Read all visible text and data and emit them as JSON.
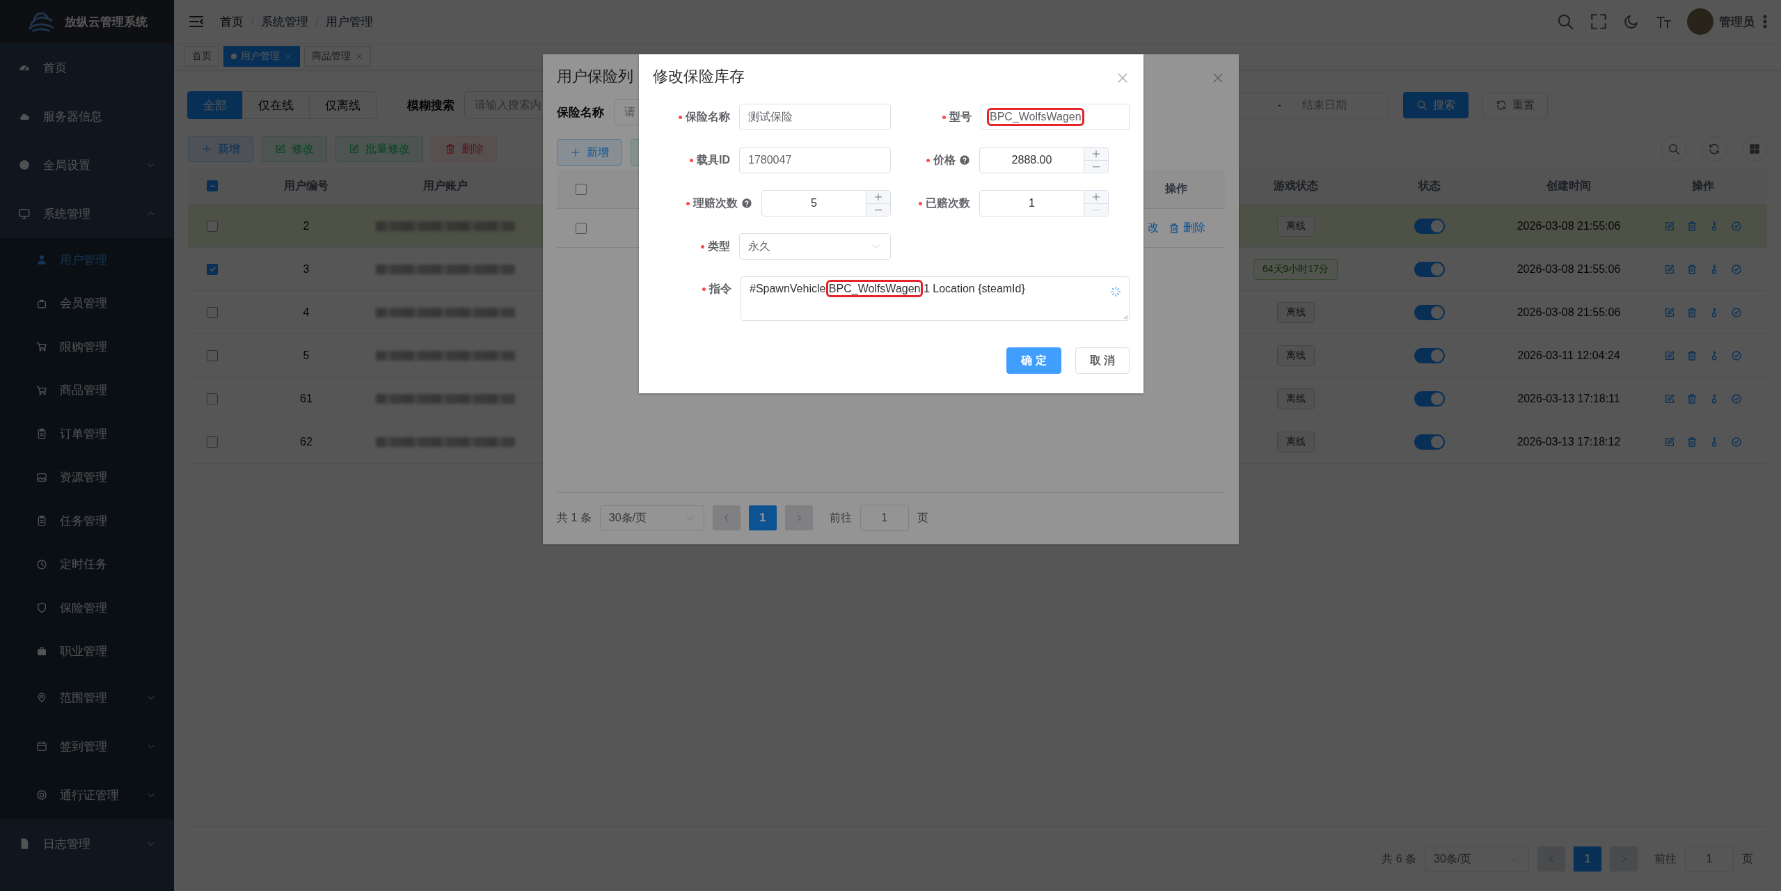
{
  "sidebar": {
    "title": "放纵云管理系统",
    "items": [
      {
        "label": "首页",
        "kind": "link",
        "selected": false
      },
      {
        "label": "服务器信息",
        "kind": "link",
        "selected": false
      },
      {
        "label": "全局设置",
        "kind": "group",
        "expanded": false,
        "selected": false
      },
      {
        "label": "系统管理",
        "kind": "group",
        "expanded": true,
        "selected": false,
        "children": [
          {
            "label": "用户管理",
            "kind": "link",
            "selected": true
          },
          {
            "label": "会员管理",
            "kind": "link",
            "selected": false
          },
          {
            "label": "限购管理",
            "kind": "link",
            "selected": false
          },
          {
            "label": "商品管理",
            "kind": "link",
            "selected": false
          },
          {
            "label": "订单管理",
            "kind": "link",
            "selected": false
          },
          {
            "label": "资源管理",
            "kind": "link",
            "selected": false
          },
          {
            "label": "任务管理",
            "kind": "link",
            "selected": false
          },
          {
            "label": "定时任务",
            "kind": "link",
            "selected": false
          },
          {
            "label": "保险管理",
            "kind": "link",
            "selected": false
          },
          {
            "label": "职业管理",
            "kind": "link",
            "selected": false
          },
          {
            "label": "范围管理",
            "kind": "group",
            "expanded": false,
            "selected": false
          },
          {
            "label": "签到管理",
            "kind": "group",
            "expanded": false,
            "selected": false
          },
          {
            "label": "通行证管理",
            "kind": "group",
            "expanded": false,
            "selected": false
          }
        ]
      },
      {
        "label": "日志管理",
        "kind": "group",
        "expanded": false,
        "selected": false
      }
    ]
  },
  "header": {
    "breadcrumb": [
      "首页",
      "系统管理",
      "用户管理"
    ],
    "user": "管理员"
  },
  "tags": [
    {
      "label": "首页",
      "selected": false,
      "closable": false
    },
    {
      "label": "用户管理",
      "selected": true,
      "closable": true
    },
    {
      "label": "商品管理",
      "selected": false,
      "closable": true
    }
  ],
  "filters": {
    "tabs": [
      {
        "label": "全部",
        "selected": true
      },
      {
        "label": "仅在线",
        "selected": false
      },
      {
        "label": "仅离线",
        "selected": false
      }
    ],
    "search_label": "模糊搜索",
    "search_placeholder": "请输入搜索内",
    "date_separator": "-",
    "end_date_placeholder": "结束日期",
    "search_button": "搜索",
    "reset_button": "重置"
  },
  "actions": [
    {
      "label": "新增",
      "kind": "add"
    },
    {
      "label": "修改",
      "kind": "edit"
    },
    {
      "label": "批量修改",
      "kind": "edit"
    },
    {
      "label": "删除",
      "kind": "delete"
    }
  ],
  "table": {
    "select_all_checked": false,
    "select_all_partial": true,
    "columns": [
      "用户编号",
      "用户账户",
      "游戏状态",
      "状态",
      "创建时间",
      "操作"
    ],
    "rows": [
      {
        "id": "2",
        "selected": false,
        "highlighted": true,
        "game_status": {
          "kind": "offline",
          "text": "离线"
        },
        "on": true,
        "created": "2026-03-08 21:55:06"
      },
      {
        "id": "3",
        "selected": true,
        "highlighted": false,
        "game_status": {
          "kind": "online",
          "text": "64天9小时17分"
        },
        "on": true,
        "created": "2026-03-08 21:55:06"
      },
      {
        "id": "4",
        "selected": false,
        "highlighted": false,
        "game_status": {
          "kind": "offline",
          "text": "离线"
        },
        "on": true,
        "created": "2026-03-08 21:55:06"
      },
      {
        "id": "5",
        "selected": false,
        "highlighted": false,
        "game_status": {
          "kind": "offline",
          "text": "离线"
        },
        "on": true,
        "created": "2026-03-11 12:04:24"
      },
      {
        "id": "61",
        "selected": false,
        "highlighted": false,
        "game_status": {
          "kind": "offline",
          "text": "离线"
        },
        "on": true,
        "created": "2026-03-13 17:18:11"
      },
      {
        "id": "62",
        "selected": false,
        "highlighted": false,
        "game_status": {
          "kind": "offline",
          "text": "离线"
        },
        "on": true,
        "created": "2026-03-13 17:18:12"
      }
    ]
  },
  "pagination": {
    "total": "共 6 条",
    "page_size": "30条/页",
    "page": "1",
    "goto_label": "前往",
    "goto_value": "1",
    "page_suffix": "页"
  },
  "list_dialog": {
    "title": "用户保险列",
    "filter_label": "保险名称",
    "filter_placeholder": "请",
    "add_button": "新增",
    "column_action": "操作",
    "select_all_checked": false,
    "select_all_partial": false,
    "rows": [
      {
        "selected": false,
        "edit_link": "改",
        "delete_link": "删除"
      }
    ],
    "pagination": {
      "total": "共 1 条",
      "page_size": "30条/页",
      "page": "1",
      "goto_label": "前往",
      "goto_value": "1",
      "page_suffix": "页"
    }
  },
  "edit_dialog": {
    "title": "修改保险库存",
    "name": {
      "label": "保险名称",
      "value": "测试保险"
    },
    "model": {
      "label": "型号",
      "value": "BPC_WolfsWagen",
      "highlighted": true
    },
    "vehicle_id": {
      "label": "载具ID",
      "value": "1780047"
    },
    "price": {
      "label": "价格",
      "value": "2888.00"
    },
    "claims": {
      "label": "理赔次数",
      "value": "5"
    },
    "claimed": {
      "label": "已赔次数",
      "value": "1"
    },
    "type": {
      "label": "类型",
      "value": "永久"
    },
    "command": {
      "label": "指令",
      "parts": [
        {
          "text": "#SpawnVehicle ",
          "highlighted": false
        },
        {
          "text": "BPC_WolfsWagen",
          "highlighted": true
        },
        {
          "text": " 1 Location {steamId}",
          "highlighted": false
        }
      ]
    },
    "confirm_button": "确 定",
    "cancel_button": "取 消"
  }
}
